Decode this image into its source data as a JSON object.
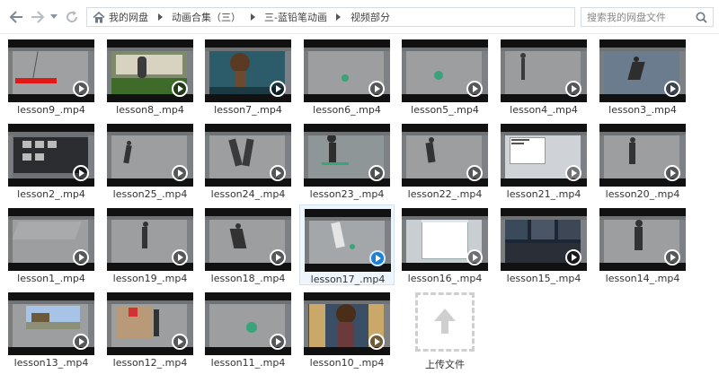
{
  "nav": {
    "back_icon": "arrow-left-icon",
    "forward_icon": "arrow-right-icon",
    "history_icon": "chevron-down-icon",
    "refresh_icon": "refresh-icon",
    "home_icon": "home-icon"
  },
  "breadcrumb": [
    "我的网盘",
    "动画合集（三）",
    "三-蓝铅笔动画",
    "视频部分"
  ],
  "search": {
    "placeholder": "搜索我的网盘文件"
  },
  "files": [
    {
      "name": "lesson9_.mp4"
    },
    {
      "name": "lesson8_.mp4"
    },
    {
      "name": "lesson7_.mp4"
    },
    {
      "name": "lesson6_.mp4"
    },
    {
      "name": "lesson5_.mp4"
    },
    {
      "name": "lesson4_.mp4"
    },
    {
      "name": "lesson3_.mp4"
    },
    {
      "name": "lesson2_.mp4"
    },
    {
      "name": "lesson25_.mp4"
    },
    {
      "name": "lesson24_.mp4"
    },
    {
      "name": "lesson23_.mp4"
    },
    {
      "name": "lesson22_.mp4"
    },
    {
      "name": "lesson21_.mp4"
    },
    {
      "name": "lesson20_.mp4"
    },
    {
      "name": "lesson1_.mp4"
    },
    {
      "name": "lesson19_.mp4"
    },
    {
      "name": "lesson18_.mp4"
    },
    {
      "name": "lesson17_.mp4",
      "selected": true
    },
    {
      "name": "lesson16_.mp4"
    },
    {
      "name": "lesson15_.mp4"
    },
    {
      "name": "lesson14_.mp4"
    },
    {
      "name": "lesson13_.mp4"
    },
    {
      "name": "lesson12_.mp4"
    },
    {
      "name": "lesson11_.mp4"
    },
    {
      "name": "lesson10_.mp4"
    }
  ],
  "upload": {
    "label": "上传文件",
    "icon": "upload-arrow-icon"
  },
  "colors": {
    "accent": "#1e7fd8",
    "selected_bg": "#eef5fd"
  }
}
